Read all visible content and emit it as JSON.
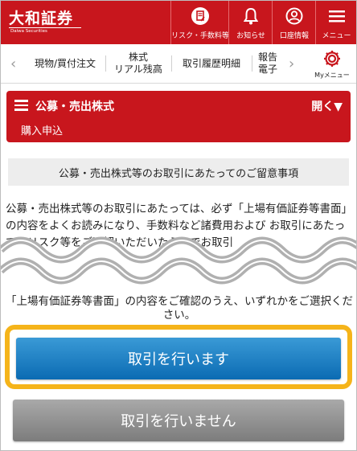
{
  "header": {
    "logo_main": "大和証券",
    "logo_sub": "Daiwa Securities",
    "buttons": [
      {
        "label": "リスク・手数料等",
        "icon": "document-pen-icon"
      },
      {
        "label": "お知らせ",
        "icon": "bell-icon"
      },
      {
        "label": "口座情報",
        "icon": "user-circle-icon"
      },
      {
        "label": "メニュー",
        "icon": "hamburger-icon"
      }
    ]
  },
  "subnav": {
    "left_arrow": "‹",
    "right_arrow": "›",
    "items": [
      "現物/買付注文",
      "株式\nリアル残高",
      "取引履歴明細",
      "報告\n電子"
    ],
    "mymenu_label": "Myメニュー"
  },
  "panel": {
    "title": "公募・売出株式",
    "toggle": "開く▼",
    "subtitle": "購入申込"
  },
  "notice": "公募・売出株式等のお取引にあたってのご留意事項",
  "body_text": "公募・売出株式等のお取引にあたっては、必ず「上場有価証券等書面」の内容をよくお読みになり、手数料など諸費用および お取引にあたってのリスク等をご理解いただいたうえでお取引",
  "confirm_text": "「上場有価証券等書面」の内容をご確認のうえ、いずれかをご選択ください。",
  "buttons": {
    "accept": "取引を行います",
    "decline": "取引を行いません"
  },
  "colors": {
    "brand_red": "#c8161d",
    "accept_blue": "#0b6bb3",
    "highlight_yellow": "#f5b41a",
    "decline_gray": "#8a8a8a"
  }
}
